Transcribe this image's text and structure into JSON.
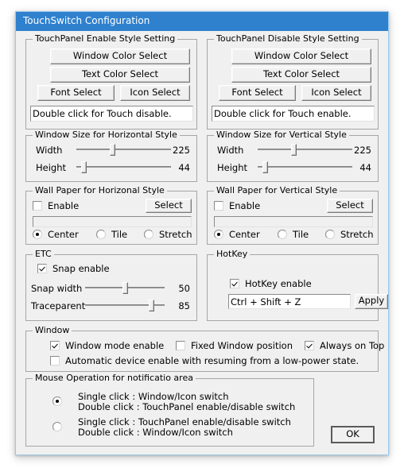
{
  "window": {
    "title": "TouchSwitch Configuration",
    "accent_color": "#2f81ce",
    "face_color": "#f0f0f0"
  },
  "enable_style": {
    "legend": "TouchPanel Enable Style Setting",
    "window_color_button": "Window Color Select",
    "text_color_button": "Text Color Select",
    "font_button": "Font Select",
    "icon_button": "Icon Select",
    "message_value": "Double click for Touch disable."
  },
  "disable_style": {
    "legend": "TouchPanel Disable Style Setting",
    "window_color_button": "Window Color Select",
    "text_color_button": "Text Color Select",
    "font_button": "Font Select",
    "icon_button": "Icon Select",
    "message_value": "Double click for Touch enable."
  },
  "size_horizontal": {
    "legend": "Window Size for Horizontal Style",
    "width_label": "Width",
    "width_value": "225",
    "height_label": "Height",
    "height_value": "44"
  },
  "size_vertical": {
    "legend": "Window Size for Vertical Style",
    "width_label": "Width",
    "width_value": "225",
    "height_label": "Height",
    "height_value": "44"
  },
  "wallpaper_horizontal": {
    "legend": "Wall Paper for Horizonal Style",
    "enable_label": "Enable",
    "enable_checked": false,
    "select_button": "Select",
    "path_value": "",
    "mode_center": "Center",
    "mode_tile": "Tile",
    "mode_stretch": "Stretch",
    "mode_selected": "Center"
  },
  "wallpaper_vertical": {
    "legend": "Wall Paper for Vertical Style",
    "enable_label": "Enable",
    "enable_checked": false,
    "select_button": "Select",
    "path_value": "",
    "mode_center": "Center",
    "mode_tile": "Tile",
    "mode_stretch": "Stretch",
    "mode_selected": "Center"
  },
  "etc": {
    "legend": "ETC",
    "snap_enable_label": "Snap enable",
    "snap_enable_checked": true,
    "snap_width_label": "Snap width",
    "snap_width_value": "50",
    "traceparent_label": "Traceparent",
    "traceparent_value": "85"
  },
  "hotkey": {
    "legend": "HotKey",
    "enable_label": "HotKey enable",
    "enable_checked": true,
    "combo_value": "Ctrl + Shift + Z",
    "apply_button": "Apply"
  },
  "window_group": {
    "legend": "Window",
    "window_mode_label": "Window mode enable",
    "window_mode_checked": true,
    "fixed_position_label": "Fixed Window position",
    "fixed_position_checked": false,
    "always_on_top_label": "Always on Top",
    "always_on_top_checked": true,
    "auto_device_label": "Automatic device enable with resuming from a low-power state.",
    "auto_device_checked": false
  },
  "mouse_operation": {
    "legend": "Mouse Operation for notificatio area",
    "option1_line1": "Single click  : Window/Icon switch",
    "option1_line2": "Double click : TouchPanel enable/disable switch",
    "option2_line1": "Single click  : TouchPanel enable/disable switch",
    "option2_line2": "Double click : Window/Icon switch",
    "selected": "option1"
  },
  "footer": {
    "ok_button": "OK"
  }
}
